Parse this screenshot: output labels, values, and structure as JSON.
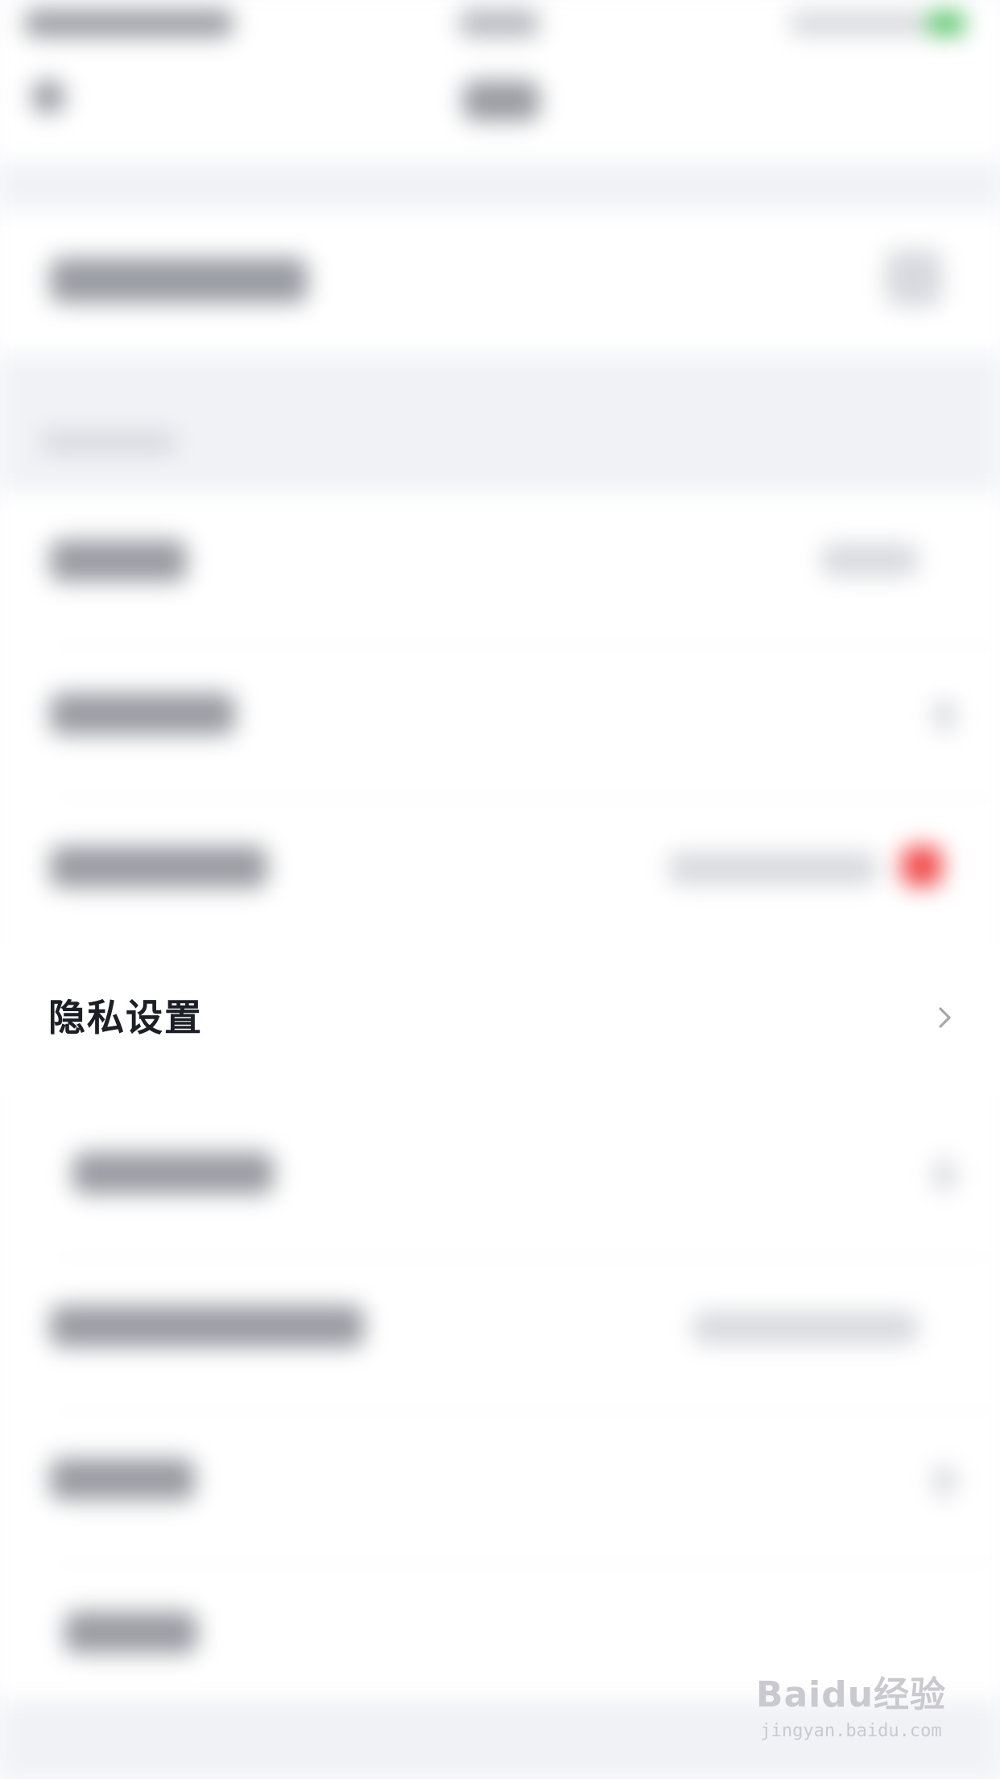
{
  "privacy_item": {
    "label": "隐私设置",
    "chevron_icon": "chevron-right-icon"
  },
  "watermark": {
    "brand": "Baidu经验",
    "url": "jingyan.baidu.com"
  },
  "colors": {
    "label_text": "#1c1f26",
    "chevron": "#a6a8ae",
    "background": "#ffffff",
    "section_gap": "#f1f2f6"
  }
}
